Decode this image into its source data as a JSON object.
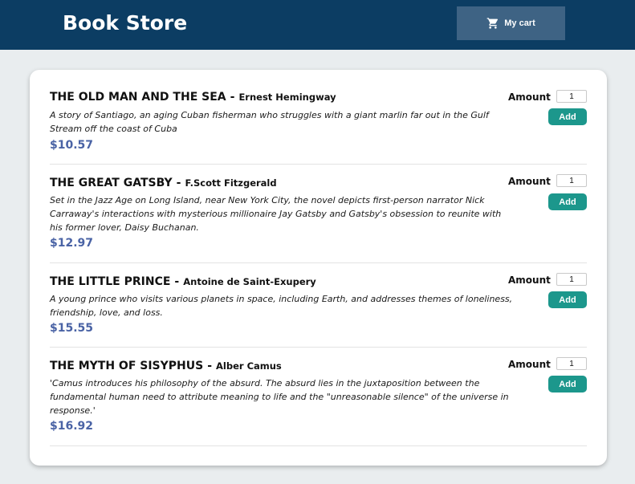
{
  "header": {
    "title": "Book Store",
    "cart_label": "My cart"
  },
  "books": [
    {
      "title": "THE OLD MAN AND THE SEA",
      "author": "Ernest Hemingway",
      "description": "A story of Santiago, an aging Cuban fisherman who struggles with a giant marlin far out in the Gulf Stream off the coast of Cuba",
      "price": "$10.57",
      "amount_label": "Amount",
      "amount": "1",
      "add_label": "Add"
    },
    {
      "title": "THE GREAT GATSBY",
      "author": "F.Scott Fitzgerald",
      "description": "Set in the Jazz Age on Long Island, near New York City, the novel depicts first-person narrator Nick Carraway's interactions with mysterious millionaire Jay Gatsby and Gatsby's obsession to reunite with his former lover, Daisy Buchanan.",
      "price": "$12.97",
      "amount_label": "Amount",
      "amount": "1",
      "add_label": "Add"
    },
    {
      "title": "THE LITTLE PRINCE",
      "author": "Antoine de Saint-Exupery",
      "description": "A young prince who visits various planets in space, including Earth, and addresses themes of loneliness, friendship, love, and loss.",
      "price": "$15.55",
      "amount_label": "Amount",
      "amount": "1",
      "add_label": "Add"
    },
    {
      "title": "THE MYTH OF SISYPHUS",
      "author": "Alber Camus",
      "description": "'Camus introduces his philosophy of the absurd. The absurd lies in the juxtaposition between the fundamental human need to attribute meaning to life and the \"unreasonable silence\" of the universe in response.'",
      "price": "$16.92",
      "amount_label": "Amount",
      "amount": "1",
      "add_label": "Add"
    }
  ],
  "icons": {
    "cart": "shopping-cart-icon"
  },
  "colors": {
    "header_bg": "#0c3d63",
    "cart_button_bg": "#3e6384",
    "price": "#4a63a5",
    "add_button": "#1c978c",
    "page_bg": "#e9edef"
  }
}
